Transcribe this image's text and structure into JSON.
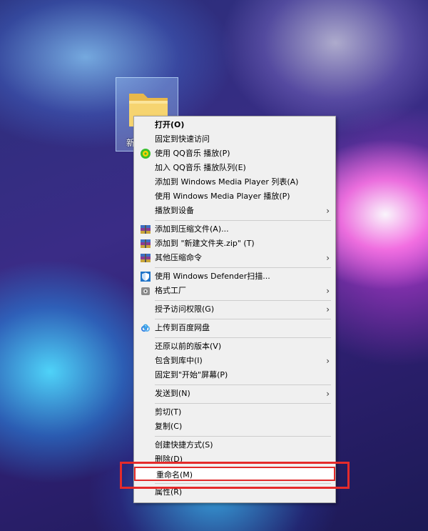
{
  "desktop": {
    "folder_label": "新"
  },
  "menu": {
    "items": [
      {
        "label": "打开(O)"
      },
      {
        "label": "固定到快速访问"
      },
      {
        "label": "使用 QQ音乐 播放(P)"
      },
      {
        "label": "加入 QQ音乐 播放队列(E)"
      },
      {
        "label": "添加到 Windows Media Player 列表(A)"
      },
      {
        "label": "使用 Windows Media Player 播放(P)"
      },
      {
        "label": "播放到设备"
      },
      {
        "label": "添加到压缩文件(A)..."
      },
      {
        "label": "添加到 \"新建文件夹.zip\" (T)"
      },
      {
        "label": "其他压缩命令"
      },
      {
        "label": "使用 Windows Defender扫描..."
      },
      {
        "label": "格式工厂"
      },
      {
        "label": "授予访问权限(G)"
      },
      {
        "label": "上传到百度网盘"
      },
      {
        "label": "还原以前的版本(V)"
      },
      {
        "label": "包含到库中(I)"
      },
      {
        "label": "固定到\"开始\"屏幕(P)"
      },
      {
        "label": "发送到(N)"
      },
      {
        "label": "剪切(T)"
      },
      {
        "label": "复制(C)"
      },
      {
        "label": "创建快捷方式(S)"
      },
      {
        "label": "删除(D)"
      },
      {
        "label": "重命名(M)"
      },
      {
        "label": "属性(R)"
      }
    ]
  },
  "colors": {
    "menu_bg": "#f0f0f0",
    "highlight_red": "#e52b2b"
  }
}
